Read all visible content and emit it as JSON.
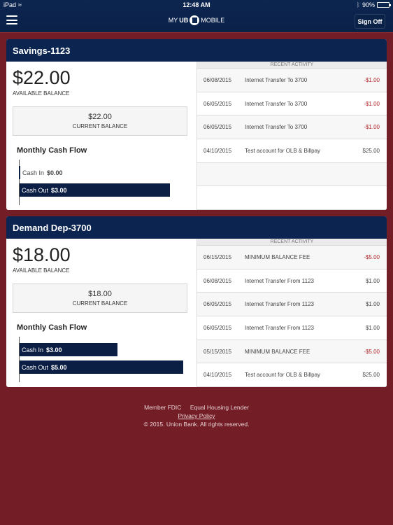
{
  "status_bar": {
    "device": "iPad",
    "time": "12:48 AM",
    "battery": "90%",
    "battery_level": 0.9
  },
  "nav": {
    "logo_prefix": "MY",
    "logo_bold": "UB",
    "logo_suffix": "MOBILE",
    "sign_off_label": "Sign Off"
  },
  "accounts": [
    {
      "name": "Savings-1123",
      "available_balance": "$22.00",
      "available_label": "AVAILABLE BALANCE",
      "current_balance": "$22.00",
      "current_label": "CURRENT BALANCE",
      "cash_flow": {
        "title": "Monthly Cash Flow",
        "cash_in_label": "Cash In",
        "cash_in_value": "$0.00",
        "cash_in": 0,
        "cash_out_label": "Cash Out",
        "cash_out_value": "$3.00",
        "cash_out": 3
      },
      "recent_activity_label": "RECENT ACTIVITY",
      "transactions": [
        {
          "date": "06/08/2015",
          "description": "Internet Transfer To 3700",
          "amount": "-$1.00",
          "negative": true
        },
        {
          "date": "06/05/2015",
          "description": "Internet Transfer To 3700",
          "amount": "-$1.00",
          "negative": true
        },
        {
          "date": "06/05/2015",
          "description": "Internet Transfer To 3700",
          "amount": "-$1.00",
          "negative": true
        },
        {
          "date": "04/10/2015",
          "description": "Test account for OLB & Billpay",
          "amount": "$25.00",
          "negative": false
        },
        {
          "date": "",
          "description": "",
          "amount": "",
          "negative": false
        },
        {
          "date": "",
          "description": "",
          "amount": "",
          "negative": false
        }
      ]
    },
    {
      "name": "Demand Dep-3700",
      "available_balance": "$18.00",
      "available_label": "AVAILABLE BALANCE",
      "current_balance": "$18.00",
      "current_label": "CURRENT BALANCE",
      "cash_flow": {
        "title": "Monthly Cash Flow",
        "cash_in_label": "Cash In",
        "cash_in_value": "$3.00",
        "cash_in": 3,
        "cash_out_label": "Cash Out",
        "cash_out_value": "$5.00",
        "cash_out": 5
      },
      "recent_activity_label": "RECENT ACTIVITY",
      "transactions": [
        {
          "date": "06/15/2015",
          "description": "MINIMUM BALANCE FEE",
          "amount": "-$5.00",
          "negative": true
        },
        {
          "date": "06/08/2015",
          "description": "Internet Transfer From 1123",
          "amount": "$1.00",
          "negative": false
        },
        {
          "date": "06/05/2015",
          "description": "Internet Transfer From 1123",
          "amount": "$1.00",
          "negative": false
        },
        {
          "date": "06/05/2015",
          "description": "Internet Transfer From 1123",
          "amount": "$1.00",
          "negative": false
        },
        {
          "date": "05/15/2015",
          "description": "MINIMUM BALANCE FEE",
          "amount": "-$5.00",
          "negative": true
        },
        {
          "date": "04/10/2015",
          "description": "Test account for OLB & Billpay",
          "amount": "$25.00",
          "negative": false
        }
      ]
    }
  ],
  "footer": {
    "member_fdic": "Member FDIC",
    "equal_housing": "Equal Housing Lender",
    "privacy_policy": "Privacy Policy",
    "copyright": "© 2015. Union Bank. All rights reserved."
  },
  "colors": {
    "navy": "#0b2450",
    "background_red": "#731d26",
    "negative_red": "#b0262a"
  }
}
